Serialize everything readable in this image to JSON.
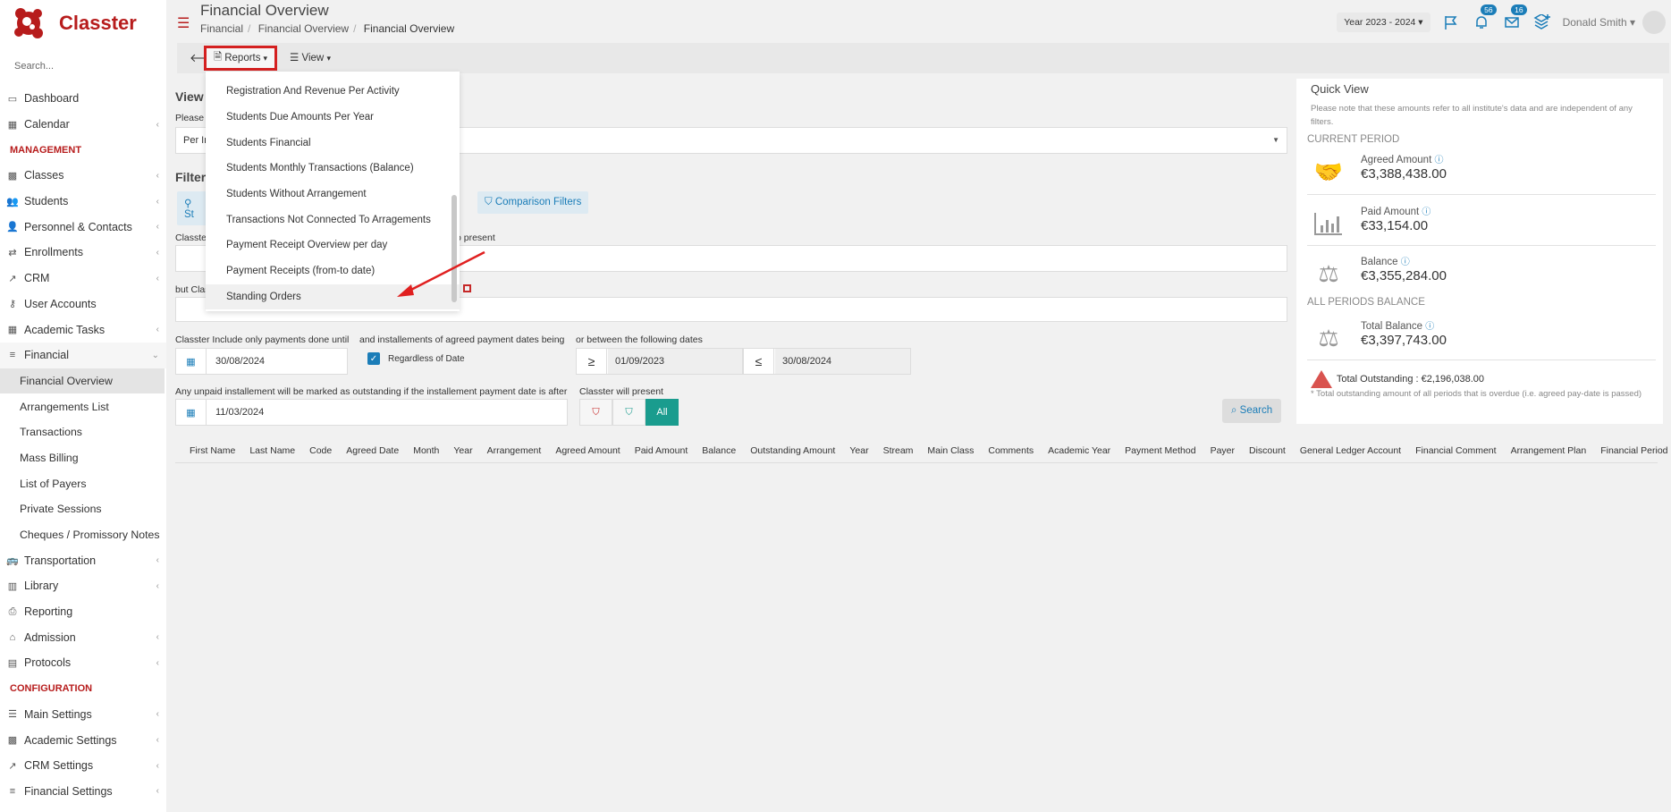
{
  "app": {
    "name": "Classter",
    "brand_color": "#b71c1c",
    "accent_color": "#1b7db8"
  },
  "sidebar": {
    "search_placeholder": "Search...",
    "items": [
      {
        "label": "Dashboard",
        "icon": "monitor-icon",
        "chevron": false
      },
      {
        "label": "Calendar",
        "icon": "calendar-icon",
        "chevron": true
      },
      {
        "section": "MANAGEMENT"
      },
      {
        "label": "Classes",
        "icon": "classes-icon",
        "chevron": true
      },
      {
        "label": "Students",
        "icon": "users-icon",
        "chevron": true
      },
      {
        "label": "Personnel & Contacts",
        "icon": "person-icon",
        "chevron": true
      },
      {
        "label": "Enrollments",
        "icon": "swap-icon",
        "chevron": true
      },
      {
        "label": "CRM",
        "icon": "chart-icon",
        "chevron": true
      },
      {
        "label": "User Accounts",
        "icon": "key-icon",
        "chevron": false
      },
      {
        "label": "Academic Tasks",
        "icon": "grid-icon",
        "chevron": true
      },
      {
        "label": "Financial",
        "icon": "coins-icon",
        "chevron": true,
        "open": true
      },
      {
        "label": "Financial Overview",
        "sub": true,
        "active": true
      },
      {
        "label": "Arrangements List",
        "sub": true
      },
      {
        "label": "Transactions",
        "sub": true
      },
      {
        "label": "Mass Billing",
        "sub": true
      },
      {
        "label": "List of Payers",
        "sub": true
      },
      {
        "label": "Private Sessions",
        "sub": true
      },
      {
        "label": "Cheques / Promissory Notes",
        "sub": true
      },
      {
        "label": "Transportation",
        "icon": "bus-icon",
        "chevron": true
      },
      {
        "label": "Library",
        "icon": "library-icon",
        "chevron": true
      },
      {
        "label": "Reporting",
        "icon": "printer-icon",
        "chevron": false
      },
      {
        "label": "Admission",
        "icon": "bank-icon",
        "chevron": true
      },
      {
        "label": "Protocols",
        "icon": "protocol-icon",
        "chevron": true
      },
      {
        "section": "CONFIGURATION"
      },
      {
        "label": "Main Settings",
        "icon": "sliders-icon",
        "chevron": true
      },
      {
        "label": "Academic Settings",
        "icon": "classes-icon",
        "chevron": true
      },
      {
        "label": "CRM Settings",
        "icon": "chart-icon",
        "chevron": true
      },
      {
        "label": "Financial Settings",
        "icon": "coins-icon",
        "chevron": true
      }
    ]
  },
  "header": {
    "title": "Financial Overview",
    "breadcrumb": [
      "Financial",
      "Financial Overview",
      "Financial Overview"
    ],
    "year_selector": "Year 2023 - 2024",
    "notifications_count": "56",
    "messages_count": "16",
    "user_name": "Donald Smith"
  },
  "toolbar": {
    "reports_label": "Reports",
    "view_label": "View"
  },
  "reports_menu": [
    "Registration And Revenue Per Activity",
    "Students Due Amounts Per Year",
    "Students Financial",
    "Students Monthly Transactions (Balance)",
    "Students Without Arrangement",
    "Transactions Not Connected To Arragements",
    "Payment Receipt Overview per day",
    "Payment Receipts (from-to date)",
    "Standing Orders"
  ],
  "main": {
    "view_heading": "View",
    "view_hint": "Please s",
    "view_select_value": "Per In",
    "filters_heading": "Filters",
    "filter_btn_students": "St",
    "filter_btn_other": "rs",
    "filter_btn_comparison": "Comparison Filters",
    "label_classter_prefix": "Classter",
    "label_to_present": "o present",
    "label_but_class": "but Clas",
    "label_include_until": "Classter Include only payments done until",
    "date_until": "30/08/2024",
    "label_installments": "and installements of agreed payment dates being",
    "regardless_label": "Regardless of Date",
    "label_between": "or between the following dates",
    "ge_symbol": "≥",
    "le_symbol": "≤",
    "date_from": "01/09/2023",
    "date_to": "30/08/2024",
    "label_unpaid": "Any unpaid installement will be marked as outstanding if the installement payment date is after",
    "date_outstanding": "11/03/2024",
    "label_will_present": "Classter will present",
    "all_label": "All",
    "search_label": "Search"
  },
  "table": {
    "columns": [
      "First Name",
      "Last Name",
      "Code",
      "Agreed Date",
      "Month",
      "Year",
      "Arrangement",
      "Agreed Amount",
      "Paid Amount",
      "Balance",
      "Outstanding Amount",
      "Year",
      "Stream",
      "Main Class",
      "Comments",
      "Academic Year",
      "Payment Method",
      "Payer",
      "Discount",
      "General Ledger Account",
      "Financial Comment",
      "Arrangement Plan",
      "Financial Period"
    ]
  },
  "quick_view": {
    "title": "Quick View",
    "note": "Please note that these amounts refer to all institute's data and are independent of any filters.",
    "current_period": "CURRENT PERIOD",
    "agreed_label": "Agreed Amount",
    "agreed_value": "€3,388,438.00",
    "paid_label": "Paid Amount",
    "paid_value": "€33,154.00",
    "balance_label": "Balance",
    "balance_value": "€3,355,284.00",
    "all_periods": "ALL PERIODS BALANCE",
    "total_balance_label": "Total Balance",
    "total_balance_value": "€3,397,743.00",
    "total_outstanding": "Total Outstanding : €2,196,038.00",
    "total_outstanding_note": "* Total outstanding amount of all periods that is overdue (i.e. agreed pay-date is passed)"
  }
}
